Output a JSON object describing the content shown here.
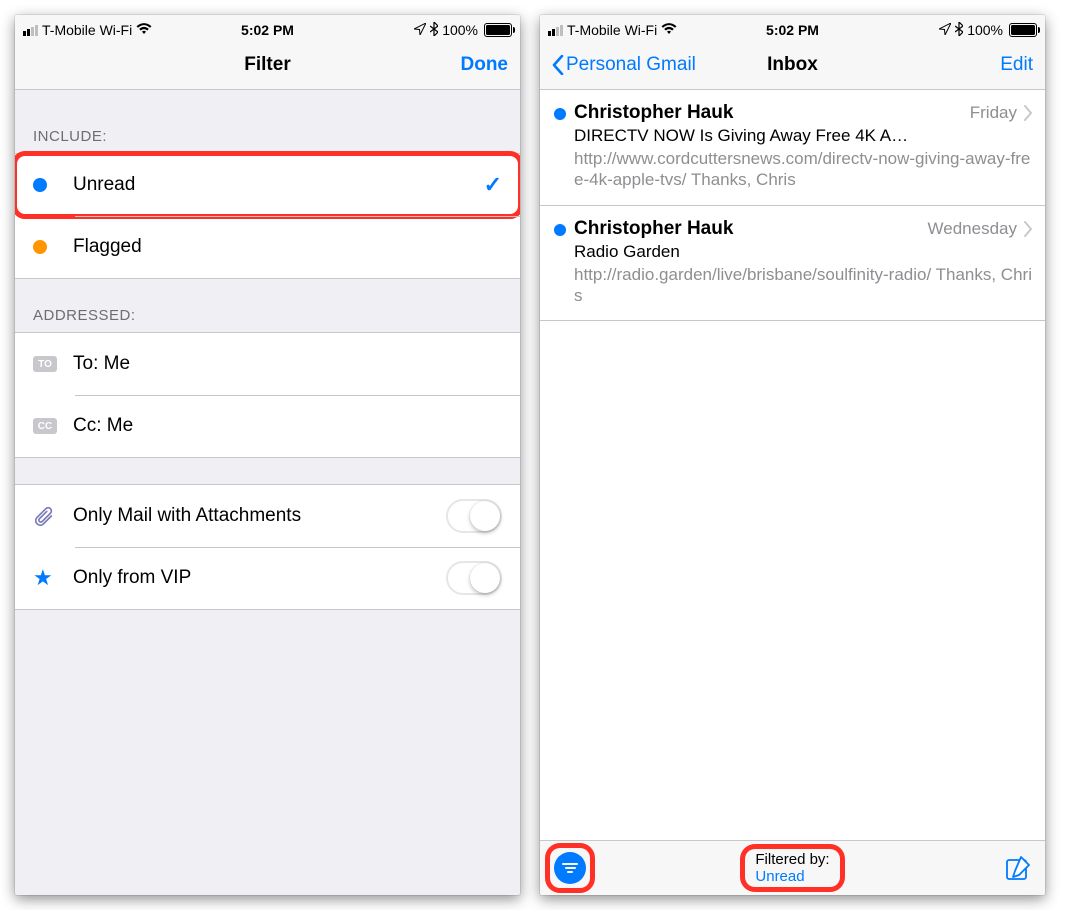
{
  "status": {
    "carrier": "T-Mobile Wi-Fi",
    "time": "5:02 PM",
    "battery_pct": "100%"
  },
  "filter_screen": {
    "title": "Filter",
    "done_label": "Done",
    "sections": {
      "include_header": "INCLUDE:",
      "addressed_header": "ADDRESSED:"
    },
    "rows": {
      "unread": "Unread",
      "flagged": "Flagged",
      "to_me": "To: Me",
      "cc_me": "Cc: Me",
      "attachments": "Only Mail with Attachments",
      "vip": "Only from VIP",
      "to_badge": "TO",
      "cc_badge": "CC"
    }
  },
  "inbox_screen": {
    "back_label": "Personal Gmail",
    "title": "Inbox",
    "edit_label": "Edit",
    "messages": [
      {
        "sender": "Christopher Hauk",
        "date": "Friday",
        "subject": "DIRECTV NOW Is Giving Away Free 4K A…",
        "preview": "http://www.cordcuttersnews.com/directv-now-giving-away-free-4k-apple-tvs/ Thanks, Chris"
      },
      {
        "sender": "Christopher Hauk",
        "date": "Wednesday",
        "subject": "Radio Garden",
        "preview": "http://radio.garden/live/brisbane/soulfinity-radio/ Thanks, Chris"
      }
    ],
    "toolbar": {
      "filtered_label": "Filtered by:",
      "filtered_value": "Unread"
    }
  }
}
